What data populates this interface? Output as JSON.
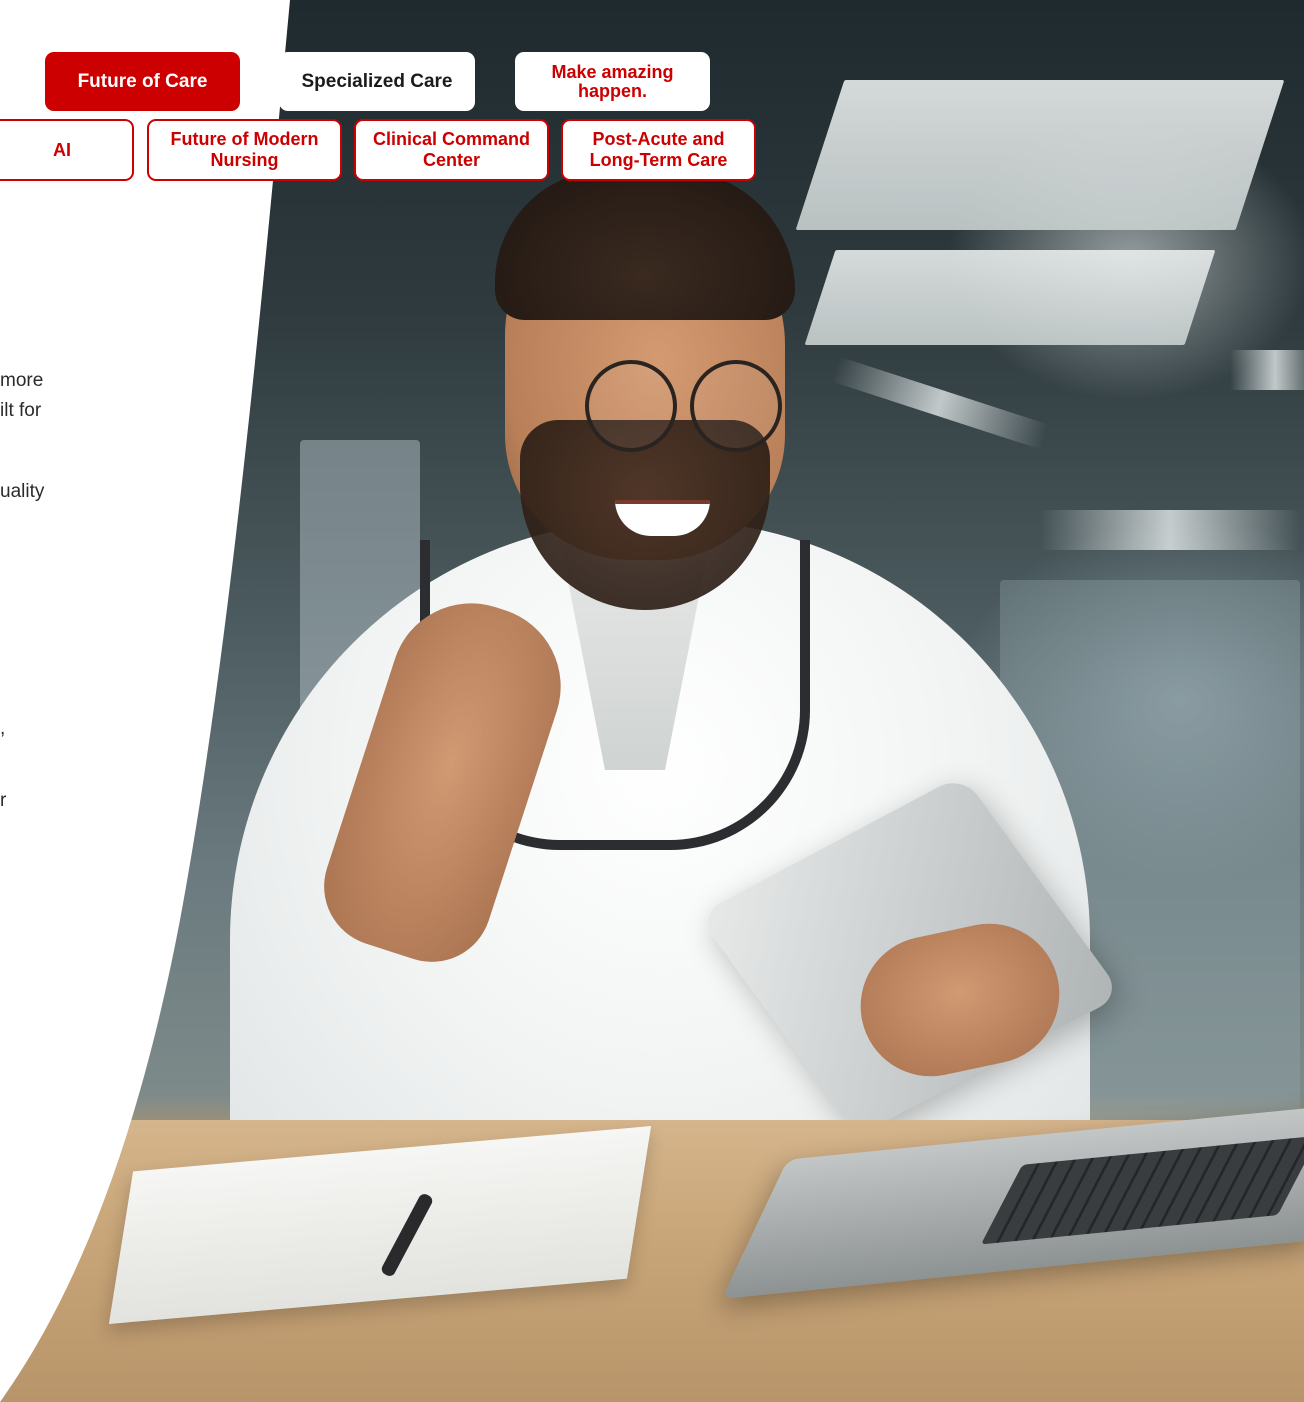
{
  "tabs_top": [
    {
      "label": "Future of Care",
      "active": true
    },
    {
      "label": "Specialized Care",
      "active": false
    },
    {
      "label": "Make amazing happen.",
      "active": false
    }
  ],
  "tabs_bottom": [
    {
      "label": "AI"
    },
    {
      "label": "Future of Modern Nursing"
    },
    {
      "label": "Clinical Command Center"
    },
    {
      "label": "Post-Acute and Long-Term Care"
    }
  ],
  "text_fragments": [
    "more",
    "ilt for",
    "uality",
    ",",
    "r"
  ],
  "colors": {
    "accent": "#cc0000",
    "text": "#2b2b2b",
    "background": "#ffffff"
  },
  "image": {
    "subject": "doctor-waving-at-tablet"
  }
}
